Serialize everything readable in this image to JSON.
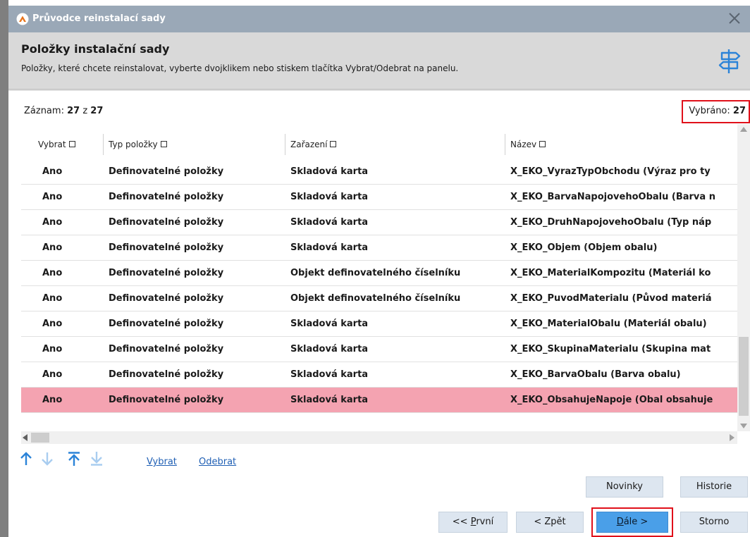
{
  "window": {
    "title": "Průvodce reinstalací sady"
  },
  "header": {
    "title": "Položky instalační sady",
    "subtitle": "Položky, které chcete reinstalovat, vyberte dvojklikem nebo stiskem tlačítka Vybrat/Odebrat na panelu."
  },
  "counters": {
    "record_label": "Záznam:",
    "record_current": "27",
    "record_of": "z",
    "record_total": "27",
    "selected_label": "Vybráno:",
    "selected_count": "27"
  },
  "grid": {
    "columns": [
      "Vybrat",
      "Typ položky",
      "Zařazení",
      "Název"
    ],
    "rows": [
      [
        "Ano",
        "Definovatelné položky",
        "Skladová karta",
        "X_EKO_VyrazTypObchodu (Výraz pro ty"
      ],
      [
        "Ano",
        "Definovatelné položky",
        "Skladová karta",
        "X_EKO_BarvaNapojovehoObalu (Barva n"
      ],
      [
        "Ano",
        "Definovatelné položky",
        "Skladová karta",
        "X_EKO_DruhNapojovehoObalu (Typ náp"
      ],
      [
        "Ano",
        "Definovatelné položky",
        "Skladová karta",
        "X_EKO_Objem (Objem obalu)"
      ],
      [
        "Ano",
        "Definovatelné položky",
        "Objekt definovatelného číselníku",
        "X_EKO_MaterialKompozitu (Materiál ko"
      ],
      [
        "Ano",
        "Definovatelné položky",
        "Objekt definovatelného číselníku",
        "X_EKO_PuvodMaterialu (Původ materiá"
      ],
      [
        "Ano",
        "Definovatelné položky",
        "Skladová karta",
        "X_EKO_MaterialObalu (Materiál obalu)"
      ],
      [
        "Ano",
        "Definovatelné položky",
        "Skladová karta",
        "X_EKO_SkupinaMaterialu (Skupina mat"
      ],
      [
        "Ano",
        "Definovatelné položky",
        "Skladová karta",
        "X_EKO_BarvaObalu (Barva obalu)"
      ],
      [
        "Ano",
        "Definovatelné položky",
        "Skladová karta",
        "X_EKO_ObsahujeNapoje (Obal obsahuje"
      ]
    ],
    "selected_row_index": 9
  },
  "toolbar": {
    "select_link": "Vybrat",
    "remove_link": "Odebrat"
  },
  "buttons": {
    "news": "Novinky",
    "history": "Historie",
    "first_prefix": "<< ",
    "first_hotkey": "P",
    "first_rest": "rvní",
    "back": "< Zpět",
    "next_hotkey": "D",
    "next_rest": "ále >",
    "cancel": "Storno"
  },
  "colors": {
    "title_bar": "#9aa8b7",
    "header_bg": "#d9d9d9",
    "selected_row": "#f4a3b1",
    "primary_button": "#4a9fe8",
    "button_bg": "#dde6f0",
    "highlight_red": "#e0101a",
    "link_blue": "#1f5fb4",
    "arrow_blue": "#2b83d8"
  },
  "icons": {
    "app": "app-logo-icon",
    "close": "close-icon",
    "header": "signpost-icon",
    "move_up": "arrow-up-icon",
    "move_down": "arrow-down-icon",
    "move_top": "arrow-top-icon",
    "move_bottom": "arrow-bottom-icon"
  }
}
